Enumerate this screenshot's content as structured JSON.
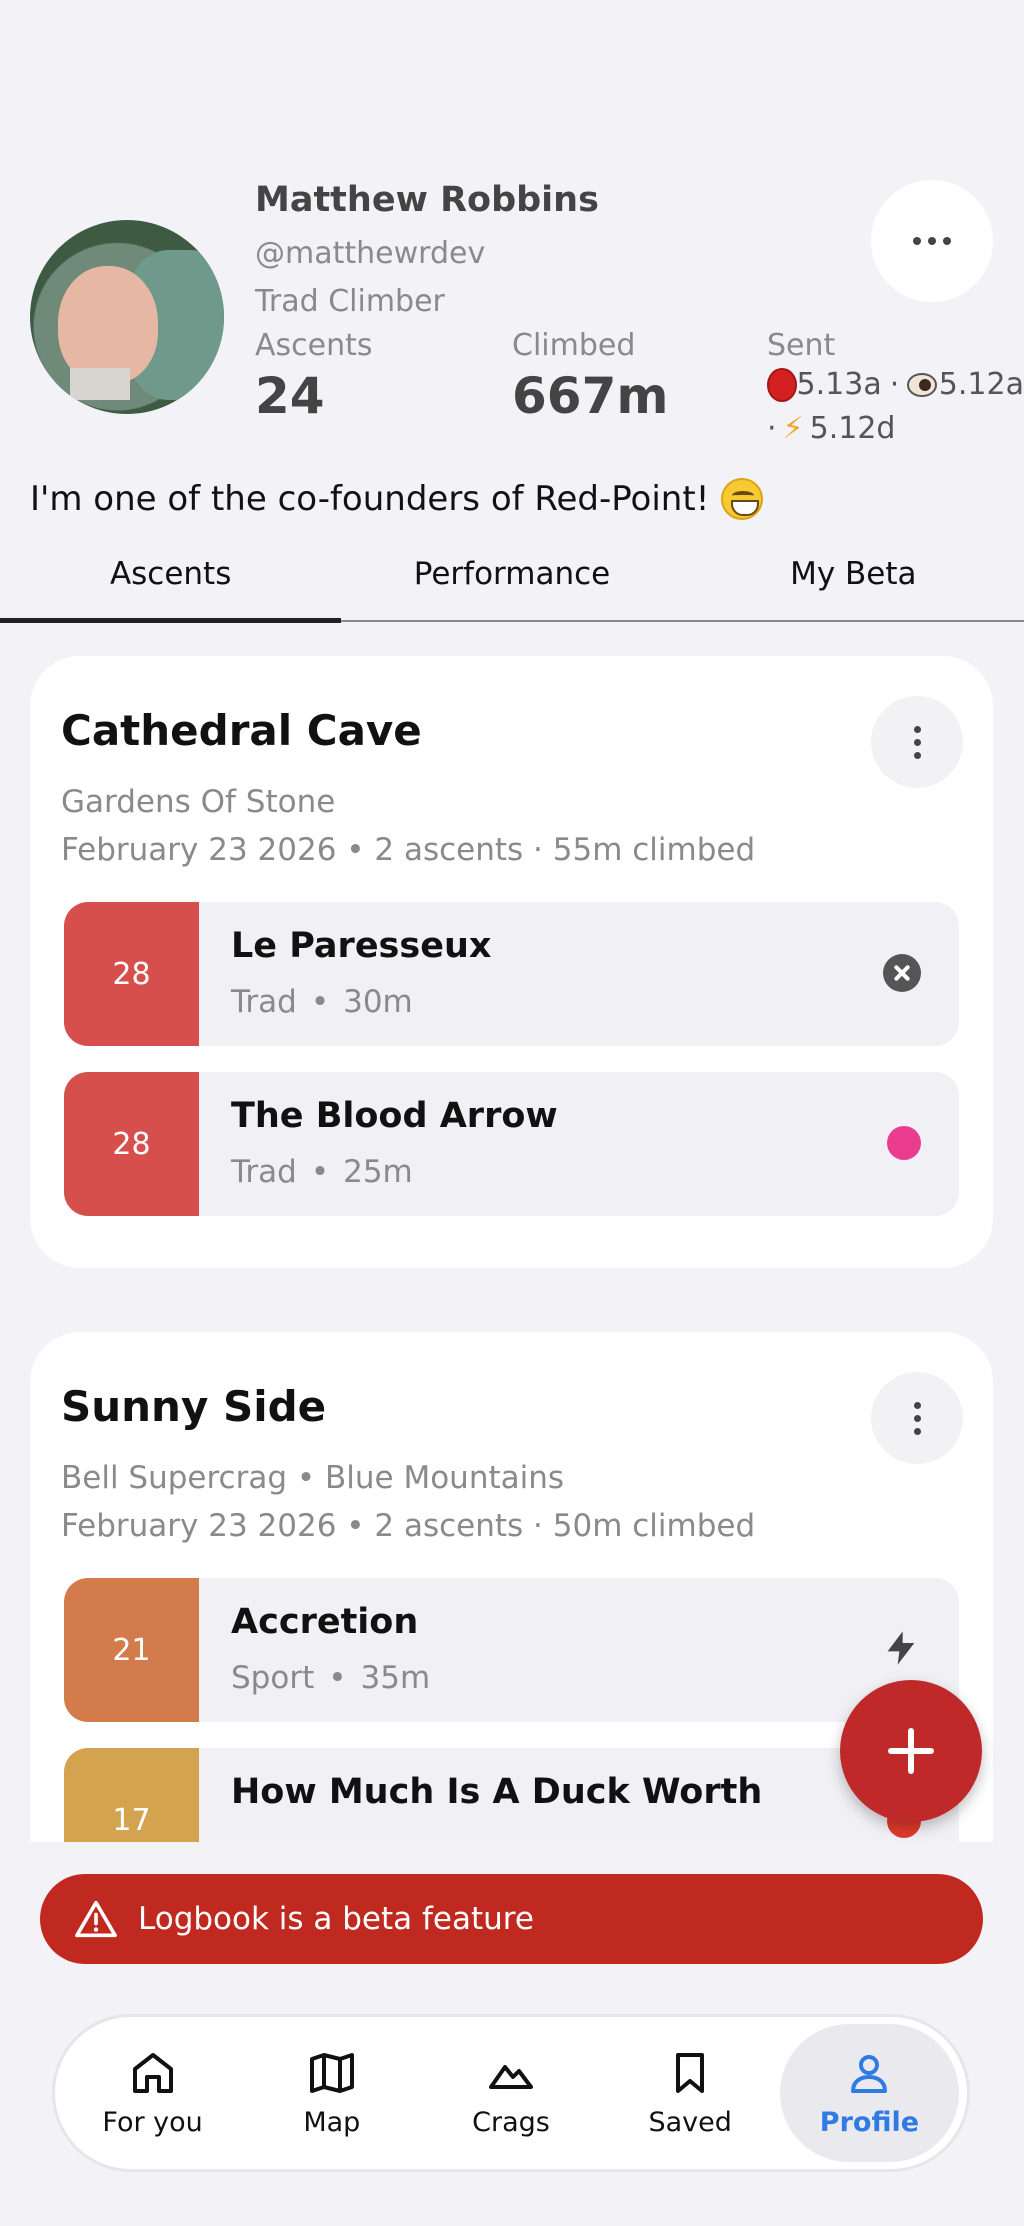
{
  "profile": {
    "name": "Matthew Robbins",
    "handle": "@matthewrdev",
    "role": "Trad Climber",
    "bio": "I'm one of the co-founders of Red-Point!",
    "stats": {
      "ascents_label": "Ascents",
      "ascents_value": "24",
      "climbed_label": "Climbed",
      "climbed_value": "667m",
      "sent_label": "Sent",
      "sent_redpoint": "5.13a",
      "sent_sep1": "·",
      "sent_onsight": "5.12a",
      "sent_sep2": "·",
      "sent_flash": "5.12d"
    }
  },
  "tabs": [
    {
      "label": "Ascents",
      "active": true
    },
    {
      "label": "Performance",
      "active": false
    },
    {
      "label": "My Beta",
      "active": false
    }
  ],
  "logbook": [
    {
      "crag": "Cathedral Cave",
      "location": "Gardens Of Stone",
      "meta": "February 23 2026 • 2 ascents · 55m climbed",
      "routes": [
        {
          "grade": "28",
          "grade_color": "#d64f4c",
          "name": "Le Paresseux",
          "style": "Trad",
          "sep": "•",
          "length": "30m",
          "status_icon": "close-circle-icon"
        },
        {
          "grade": "28",
          "grade_color": "#d64f4c",
          "name": "The Blood Arrow",
          "style": "Trad",
          "sep": "•",
          "length": "25m",
          "status_icon": "pink-dot-icon"
        }
      ]
    },
    {
      "crag": "Sunny Side",
      "location": "Bell Supercrag • Blue Mountains",
      "meta": "February 23 2026 • 2 ascents · 50m climbed",
      "routes": [
        {
          "grade": "21",
          "grade_color": "#d47b4c",
          "name": "Accretion",
          "style": "Sport",
          "sep": "•",
          "length": "35m",
          "status_icon": "bolt-icon"
        },
        {
          "grade": "17",
          "grade_color": "#d4a350",
          "name": "How Much Is A Duck Worth",
          "style": "",
          "sep": "",
          "length": "",
          "status_icon": "red-dot-icon"
        }
      ]
    }
  ],
  "banner": {
    "text": "Logbook is a beta feature"
  },
  "nav": [
    {
      "label": "For you",
      "icon": "home-icon",
      "active": false
    },
    {
      "label": "Map",
      "icon": "map-icon",
      "active": false
    },
    {
      "label": "Crags",
      "icon": "mountain-icon",
      "active": false
    },
    {
      "label": "Saved",
      "icon": "bookmark-icon",
      "active": false
    },
    {
      "label": "Profile",
      "icon": "user-icon",
      "active": true
    }
  ],
  "colors": {
    "accent": "#c0292a",
    "nav_active": "#2f7be3",
    "background": "#f3f2f7"
  }
}
